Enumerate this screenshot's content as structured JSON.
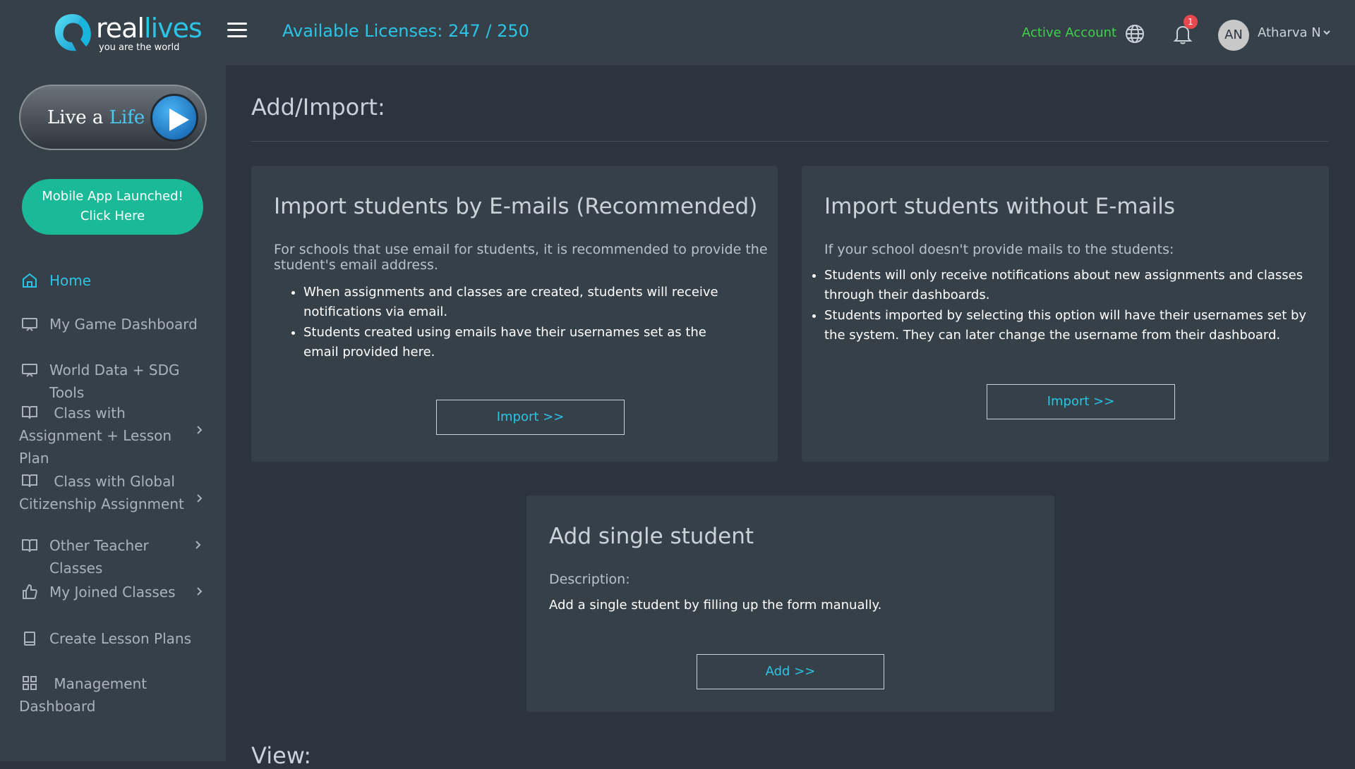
{
  "brand": {
    "name_part1": "real",
    "name_part2": "lives",
    "tagline": "you are the world"
  },
  "sidebar": {
    "live_a_life": {
      "prefix": "Live a",
      "highlight": "Life"
    },
    "mobile_app": {
      "line1": "Mobile App Launched!",
      "line2": "Click Here"
    },
    "items": [
      {
        "label": "Home",
        "icon": "home-icon",
        "active": true
      },
      {
        "label": "My Game Dashboard",
        "icon": "monitor-icon"
      },
      {
        "label": "World Data + SDG Tools",
        "icon": "monitor-icon"
      },
      {
        "label": "Class with Assignment + Lesson Plan",
        "icon": "book-icon",
        "has_children": true
      },
      {
        "label": "Class with Global Citizenship Assignment",
        "icon": "book-icon",
        "has_children": true
      },
      {
        "label": "Other Teacher Classes",
        "icon": "book-icon",
        "has_children": true
      },
      {
        "label": "My Joined Classes",
        "icon": "thumbs-up-icon",
        "has_children": true
      },
      {
        "label": "Create Lesson Plans",
        "icon": "notebook-icon"
      },
      {
        "label": "Management Dashboard",
        "icon": "grid-icon"
      }
    ]
  },
  "header": {
    "licenses": "Available Licenses: 247 / 250",
    "account_status": "Active Account",
    "notification_count": "1",
    "user_initials": "AN",
    "user_name": "Atharva N"
  },
  "main": {
    "title": "Add/Import:",
    "card_email": {
      "title": "Import students by E-mails (Recommended)",
      "subtitle": "For schools that use email for students, it is recommended to provide the student's email address.",
      "bullets": [
        "When assignments and classes are created, students will receive notifications via email.",
        "Students created using emails have their usernames set as the email provided here."
      ],
      "button": "Import >>"
    },
    "card_no_email": {
      "title": "Import students without E-mails",
      "subtitle": "If your school doesn't provide mails to the students:",
      "bullets": [
        "Students will only receive notifications about new assignments and classes through their dashboards.",
        "Students imported by selecting this option will have their usernames set by the system. They can later change the username from their dashboard."
      ],
      "button": "Import >>"
    },
    "card_single": {
      "title": "Add single student",
      "description_label": "Description:",
      "description": "Add a single student by filling up the form manually.",
      "button": "Add >>"
    },
    "view_title": "View:"
  },
  "colors": {
    "accent": "#2bc4e6",
    "active_status": "#3ed14a",
    "mobile_button": "#1ab998",
    "badge": "#e5484d",
    "background": "#2c3440",
    "panel": "#364049"
  }
}
